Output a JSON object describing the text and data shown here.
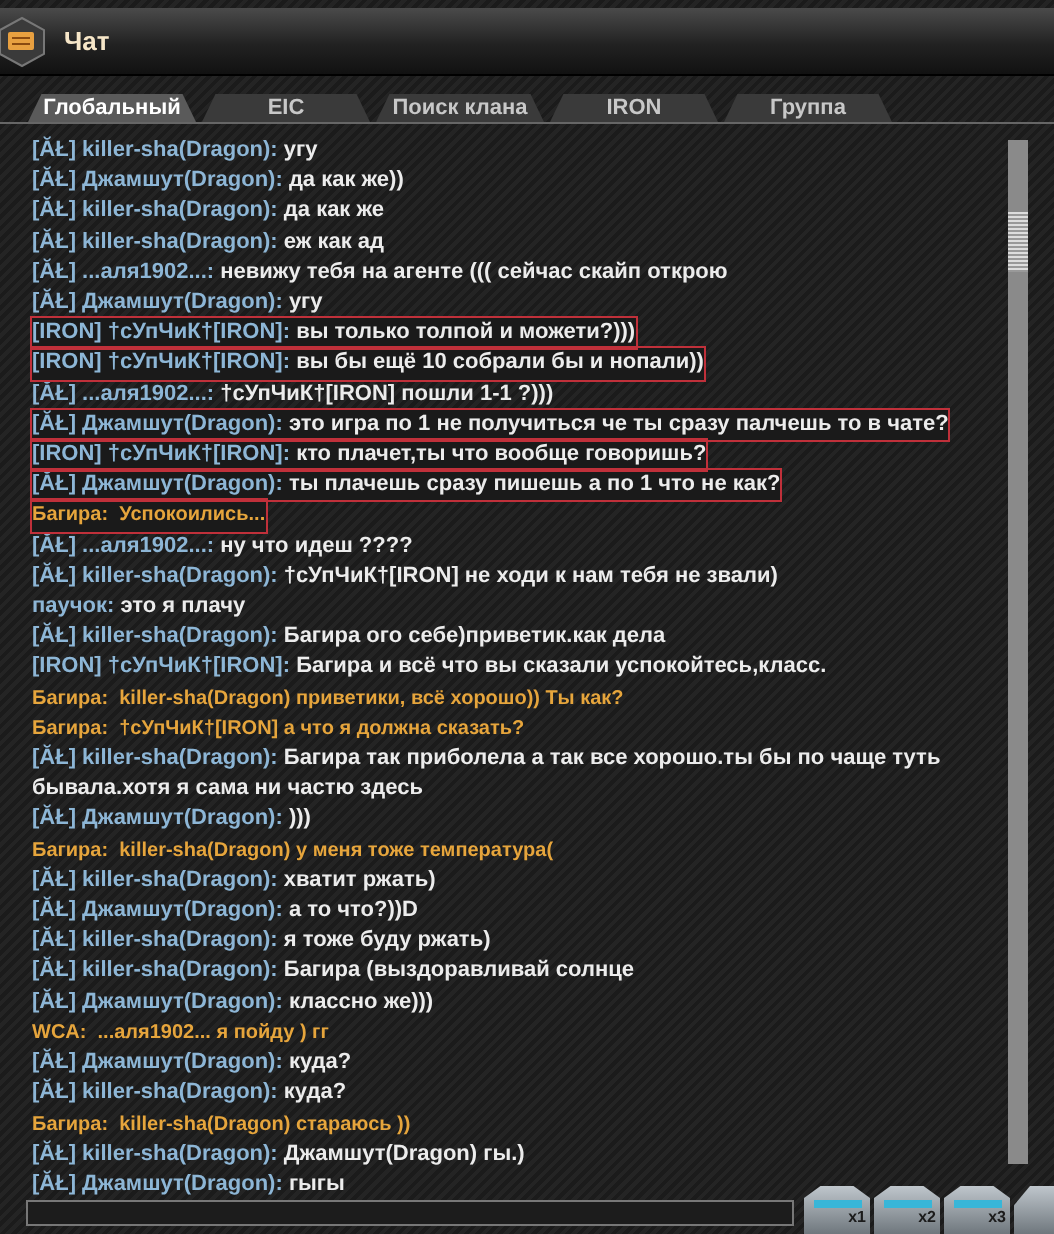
{
  "window": {
    "title": "Чат"
  },
  "tabs": [
    {
      "label": "Глобальный",
      "selected": true
    },
    {
      "label": "EIC",
      "selected": false
    },
    {
      "label": "Поиск клана",
      "selected": false
    },
    {
      "label": "IRON",
      "selected": false
    },
    {
      "label": "Группа",
      "selected": false
    }
  ],
  "messages": [
    {
      "kind": "user",
      "name": "[ĂŁ] killer-sha(Dragon):",
      "text": "угу",
      "highlighted": false
    },
    {
      "kind": "user",
      "name": "[ĂŁ] Джамшут(Dragon):",
      "text": "да как же))",
      "highlighted": false
    },
    {
      "kind": "user",
      "name": "[ĂŁ] killer-sha(Dragon):",
      "text": "да как же",
      "highlighted": false
    },
    {
      "kind": "user",
      "name": "[ĂŁ] killer-sha(Dragon):",
      "text": "еж как ад",
      "highlighted": false
    },
    {
      "kind": "user",
      "name": "[ĂŁ] ...аля1902...:",
      "text": "невижу тебя на агенте ((( сейчас скайп открою",
      "highlighted": false
    },
    {
      "kind": "user",
      "name": "[ĂŁ] Джамшут(Dragon):",
      "text": "угу",
      "highlighted": false
    },
    {
      "kind": "user",
      "name": "[IRON] †сУпЧиК†[IRON]:",
      "text": "вы только толпой и можети?)))",
      "highlighted": true
    },
    {
      "kind": "user",
      "name": "[IRON] †сУпЧиК†[IRON]:",
      "text": "вы бы ещё 10 собрали бы и нопали))",
      "highlighted": true
    },
    {
      "kind": "user",
      "name": "[ĂŁ] ...аля1902...:",
      "text": "†сУпЧиК†[IRON]  пошли 1-1 ?)))",
      "highlighted": false
    },
    {
      "kind": "user",
      "name": "[ĂŁ] Джамшут(Dragon):",
      "text": "это игра по 1 не получиться че ты сразу палчешь то в чате?",
      "highlighted": true
    },
    {
      "kind": "user",
      "name": "[IRON] †сУпЧиК†[IRON]:",
      "text": "кто плачет,ты что вообще говоришь?",
      "highlighted": true
    },
    {
      "kind": "user",
      "name": "[ĂŁ] Джамшут(Dragon):",
      "text": "ты плачешь сразу пишешь а по 1 что не как?",
      "highlighted": true
    },
    {
      "kind": "notice",
      "name": "Багира:",
      "text": "Успокоились...",
      "highlighted": true
    },
    {
      "kind": "user",
      "name": "[ĂŁ] ...аля1902...:",
      "text": "ну что идеш ????",
      "highlighted": false
    },
    {
      "kind": "user",
      "name": "[ĂŁ] killer-sha(Dragon):",
      "text": "†сУпЧиК†[IRON] не ходи к нам тебя не звали)",
      "highlighted": false
    },
    {
      "kind": "user",
      "name": "паучок:",
      "text": "это я плачу",
      "highlighted": false
    },
    {
      "kind": "user",
      "name": "[ĂŁ] killer-sha(Dragon):",
      "text": "Багира ого себе)приветик.как дела",
      "highlighted": false
    },
    {
      "kind": "user",
      "name": "[IRON] †сУпЧиК†[IRON]:",
      "text": "Багира и всё что вы сказали успокойтесь,класс.",
      "highlighted": false
    },
    {
      "kind": "notice",
      "name": "Багира:",
      "text": "killer-sha(Dragon) приветики, всё хорошо)) Ты как?",
      "highlighted": false
    },
    {
      "kind": "notice",
      "name": "Багира:",
      "text": "†сУпЧиК†[IRON] а что я должна сказать?",
      "highlighted": false
    },
    {
      "kind": "user",
      "name": "[ĂŁ] killer-sha(Dragon):",
      "text": "Багира так приболела а так все хорошо.ты бы по чаще туть бывала.хотя я сама ни частю здесь",
      "highlighted": false
    },
    {
      "kind": "user",
      "name": "[ĂŁ] Джамшут(Dragon):",
      "text": ")))",
      "highlighted": false
    },
    {
      "kind": "notice",
      "name": "Багира:",
      "text": "killer-sha(Dragon) у меня тоже температура(",
      "highlighted": false
    },
    {
      "kind": "user",
      "name": "[ĂŁ] killer-sha(Dragon):",
      "text": "хватит ржать)",
      "highlighted": false
    },
    {
      "kind": "user",
      "name": "[ĂŁ] Джамшут(Dragon):",
      "text": "а то что?))D",
      "highlighted": false
    },
    {
      "kind": "user",
      "name": "[ĂŁ] killer-sha(Dragon):",
      "text": "я тоже буду ржать)",
      "highlighted": false
    },
    {
      "kind": "user",
      "name": "[ĂŁ] killer-sha(Dragon):",
      "text": "Багира (выздоравливай солнце",
      "highlighted": false
    },
    {
      "kind": "user",
      "name": "[ĂŁ] Джамшут(Dragon):",
      "text": "классно же)))",
      "highlighted": false
    },
    {
      "kind": "notice",
      "name": "WCA:",
      "text": "...аля1902... я пойду ) гг",
      "highlighted": false
    },
    {
      "kind": "user",
      "name": "[ĂŁ] Джамшут(Dragon):",
      "text": "куда?",
      "highlighted": false
    },
    {
      "kind": "user",
      "name": "[ĂŁ] killer-sha(Dragon):",
      "text": "куда?",
      "highlighted": false
    },
    {
      "kind": "notice",
      "name": "Багира:",
      "text": "killer-sha(Dragon) стараюсь ))",
      "highlighted": false
    },
    {
      "kind": "user",
      "name": "[ĂŁ] killer-sha(Dragon):",
      "text": "Джамшут(Dragon) гы.)",
      "highlighted": false
    },
    {
      "kind": "user",
      "name": "[ĂŁ] Джамшут(Dragon):",
      "text": "гыгы",
      "highlighted": false
    }
  ],
  "bottom_buttons": [
    {
      "label": "x1"
    },
    {
      "label": "x2"
    },
    {
      "label": "x3"
    }
  ]
}
